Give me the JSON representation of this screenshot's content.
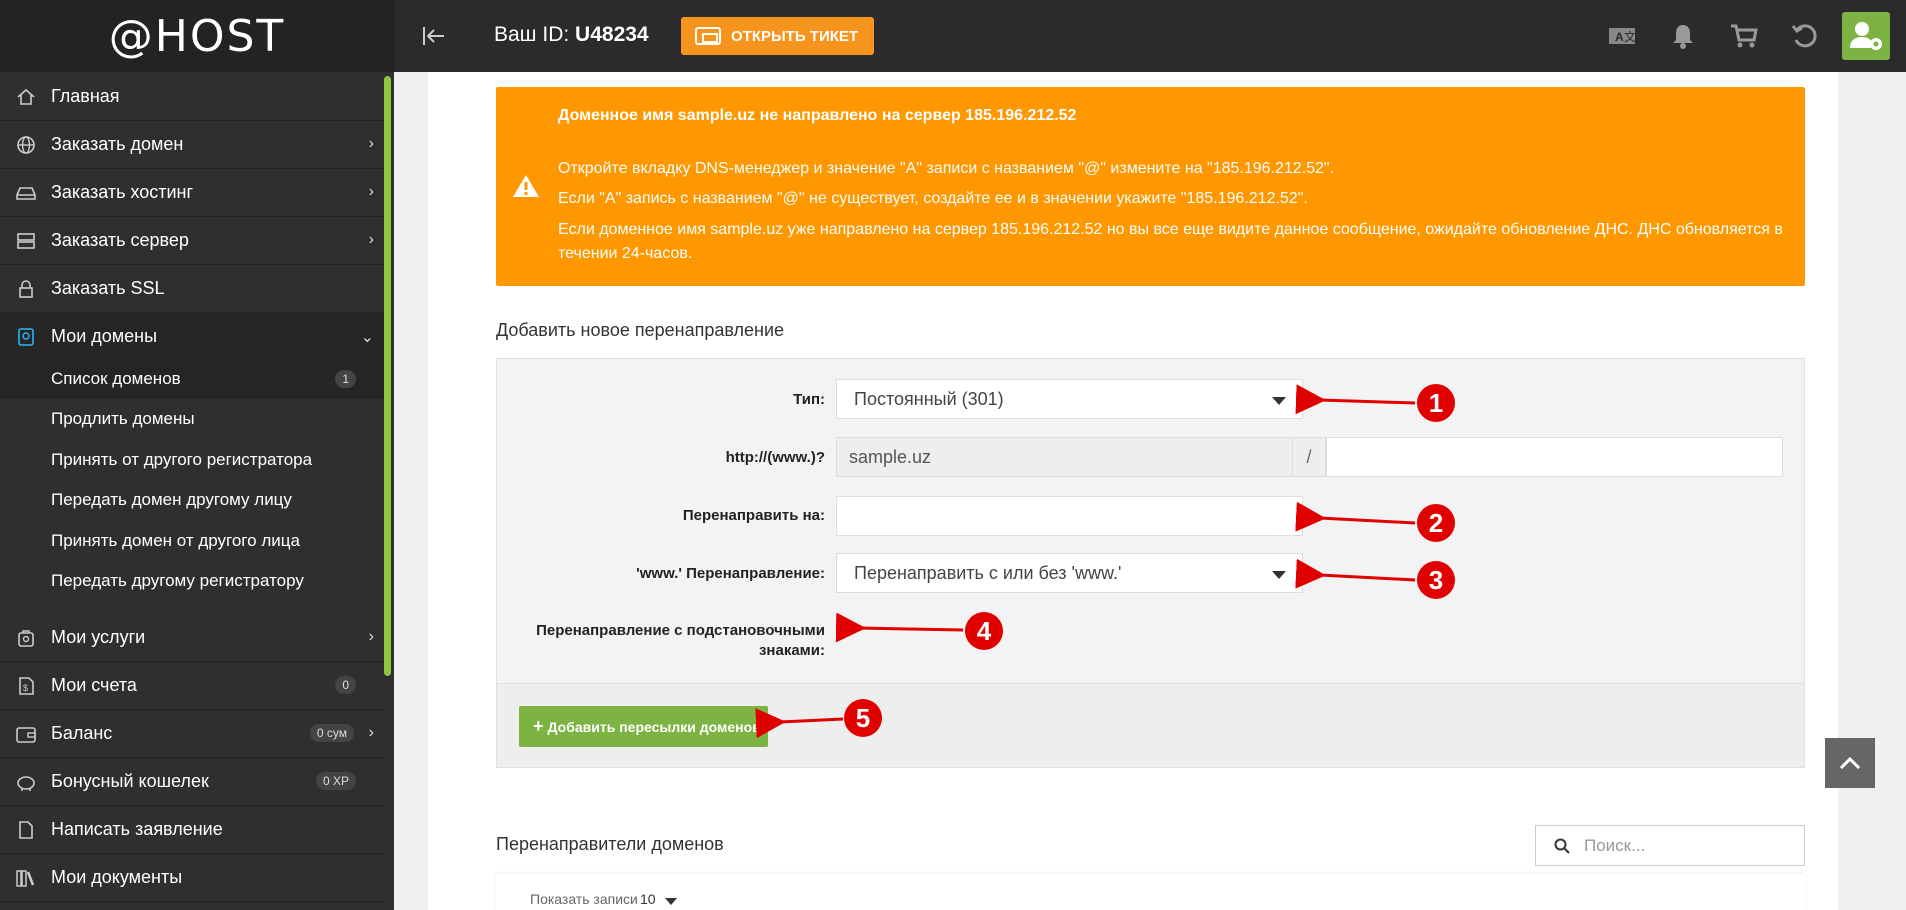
{
  "app": {
    "logo": "@HOST"
  },
  "header": {
    "user_id_label": "Ваш ID:",
    "user_id_value": "U48234",
    "ticket_button": "ОТКРЫТЬ ТИКЕТ",
    "icons": [
      "translate-icon",
      "bell-icon",
      "cart-icon",
      "refresh-icon",
      "user-settings-icon"
    ]
  },
  "sidebar": {
    "items": [
      {
        "label": "Главная",
        "icon": "home-icon"
      },
      {
        "label": "Заказать домен",
        "icon": "globe-icon",
        "chevron": "›"
      },
      {
        "label": "Заказать хостинг",
        "icon": "hdd-icon",
        "chevron": "›"
      },
      {
        "label": "Заказать сервер",
        "icon": "server-icon",
        "chevron": "›"
      },
      {
        "label": "Заказать SSL",
        "icon": "lock-icon"
      },
      {
        "label": "Мои домены",
        "icon": "domain-icon",
        "chevron": "⌄"
      },
      {
        "label": "Мои услуги",
        "icon": "services-icon",
        "chevron": "›"
      },
      {
        "label": "Мои счета",
        "icon": "invoice-icon",
        "badge": "0"
      },
      {
        "label": "Баланс",
        "icon": "wallet-icon",
        "badge": "0 сум",
        "chevron": "›"
      },
      {
        "label": "Бонусный кошелек",
        "icon": "piggy-bank-icon",
        "badge": "0 XP"
      },
      {
        "label": "Написать заявление",
        "icon": "document-icon"
      },
      {
        "label": "Мои документы",
        "icon": "books-icon"
      }
    ],
    "sub_items": [
      {
        "label": "Список доменов",
        "badge": "1"
      },
      {
        "label": "Продлить домены"
      },
      {
        "label": "Принять от другого регистратора"
      },
      {
        "label": "Передать домен другому лицу"
      },
      {
        "label": "Принять домен от другого лица"
      },
      {
        "label": "Передать другому регистратору"
      }
    ]
  },
  "alert": {
    "title": "Доменное имя sample.uz не направлено на сервер 185.196.212.52",
    "lines": [
      "Откройте вкладку DNS-менеджер и значение \"A\" записи с названием \"@\" измените на \"185.196.212.52\".",
      "Если \"A\" запись с названием \"@\" не существует, создайте ее и в значении укажите \"185.196.212.52\".",
      "Если доменное имя sample.uz уже направлено на сервер 185.196.212.52 но вы все еще видите данное сообщение, ожидайте обновление ДНС. ДНС обновляется в",
      "течении 24-часов."
    ]
  },
  "form": {
    "section_title": "Добавить новое перенаправление",
    "type_label": "Тип:",
    "type_value": "Постоянный (301)",
    "http_label": "http://(www.)?",
    "domain_value": "sample.uz",
    "slash": "/",
    "path_value": "",
    "redirect_to_label": "Перенаправить на:",
    "redirect_to_value": "",
    "www_label": "'www.' Перенаправление:",
    "www_value": "Перенаправить с или без 'www.'",
    "wildcard_label_1": "Перенаправление с подстановочными",
    "wildcard_label_2": "знаками:",
    "wildcard_checked": true,
    "add_button": "Добавить пересылки доменов"
  },
  "redirects": {
    "section_title": "Перенаправители доменов",
    "search_placeholder": "Поиск...",
    "show_label": "Показать записи",
    "show_value": "10"
  },
  "annotations": [
    "1",
    "2",
    "3",
    "4",
    "5"
  ],
  "colors": {
    "accent_orange": "#ff9800",
    "green": "#7cb342",
    "annotation_red": "#e10000"
  }
}
